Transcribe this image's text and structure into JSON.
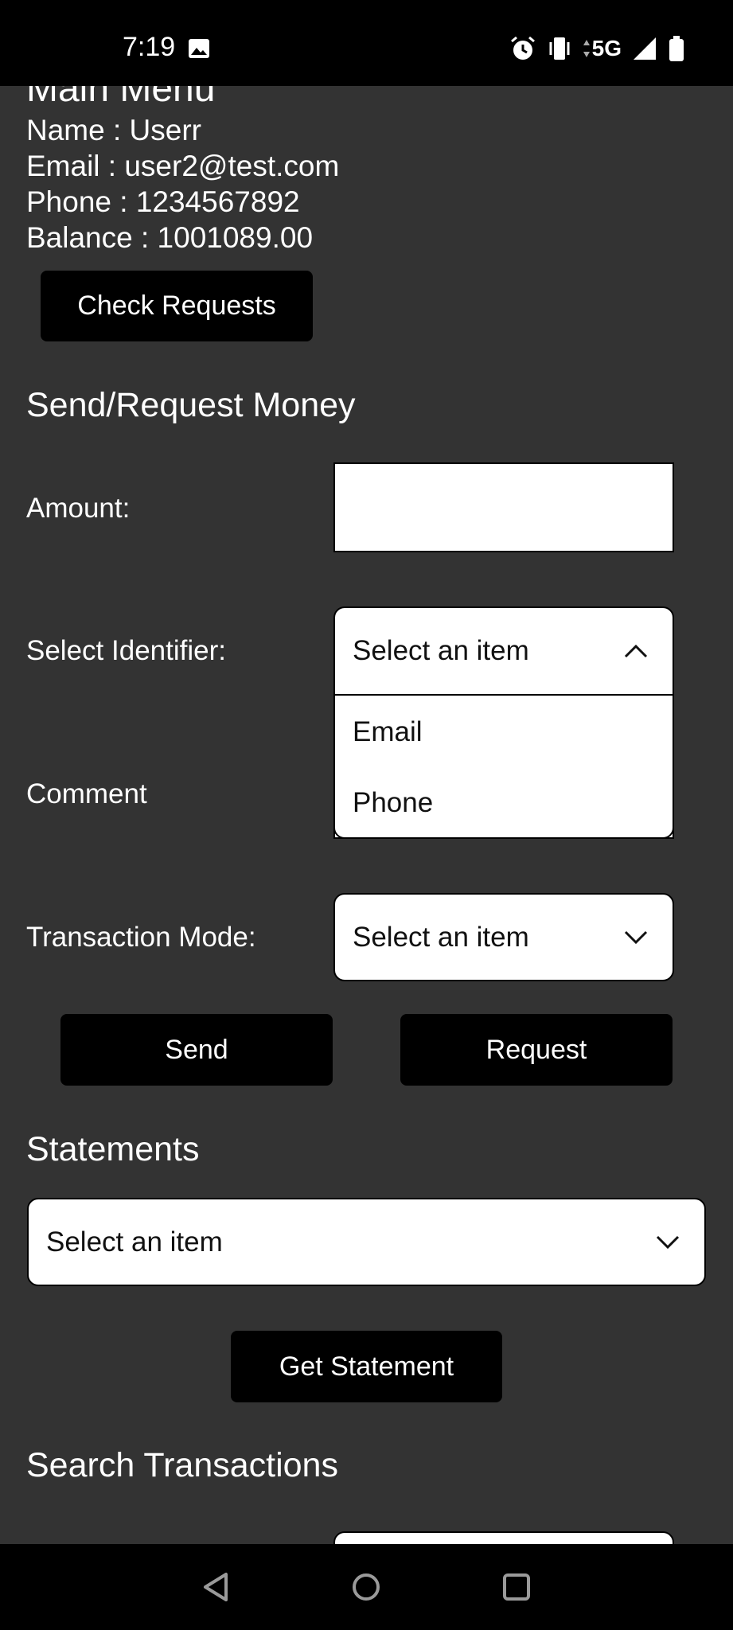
{
  "status_bar": {
    "time": "7:19",
    "network": "5G",
    "icons": [
      "image-icon",
      "alarm-icon",
      "vibrate-icon",
      "data-arrows-icon",
      "signal-icon",
      "battery-icon"
    ]
  },
  "header": {
    "title": "Main Menu"
  },
  "user": {
    "name_line": "Name : Userr",
    "email_line": "Email : user2@test.com",
    "phone_line": "Phone : 1234567892",
    "balance_line": "Balance : 1001089.00"
  },
  "check_requests_label": "Check Requests",
  "send_request": {
    "title": "Send/Request Money",
    "amount_label": "Amount:",
    "amount_value": "",
    "identifier_label": "Select Identifier:",
    "identifier_placeholder": "Select an item",
    "identifier_options": [
      "Email",
      "Phone"
    ],
    "comment_label": "Comment",
    "mode_label": "Transaction Mode:",
    "mode_placeholder": "Select an item",
    "send_label": "Send",
    "request_label": "Request"
  },
  "statements": {
    "title": "Statements",
    "select_placeholder": "Select an item",
    "button_label": "Get Statement"
  },
  "search": {
    "title": "Search Transactions"
  },
  "colors": {
    "background": "#333333",
    "button": "#000000",
    "field": "#ffffff"
  }
}
